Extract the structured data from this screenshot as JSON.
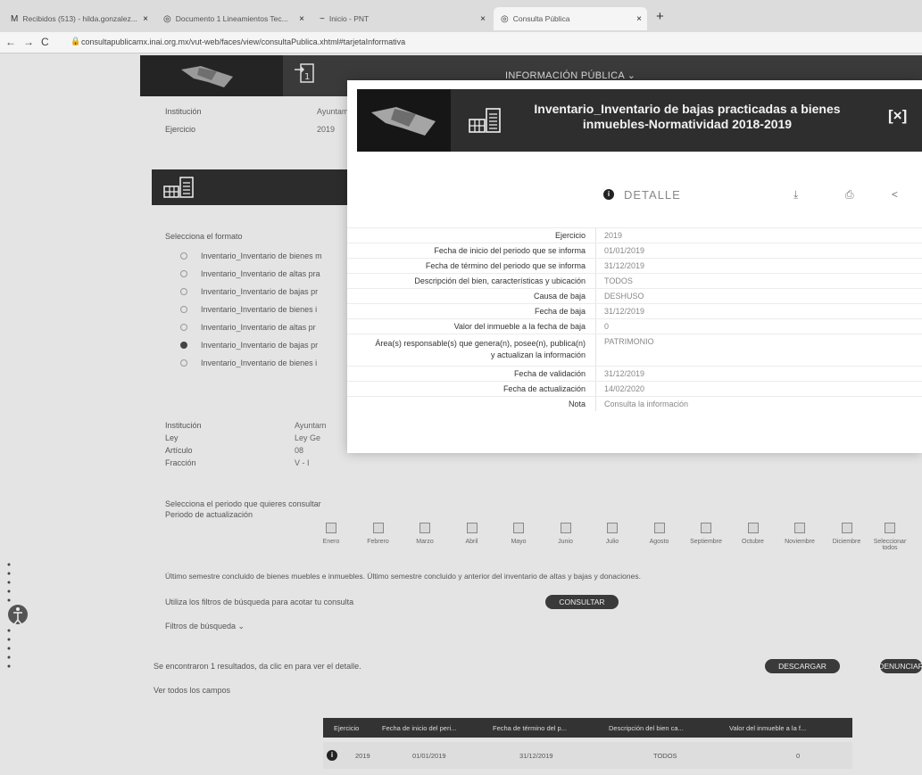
{
  "browser": {
    "tabs": [
      {
        "icon": "M",
        "label": "Recibidos (513) - hilda.gonzalez..."
      },
      {
        "icon": "◎",
        "label": "Documento 1 Lineamientos Tec..."
      },
      {
        "icon": "~",
        "label": "Inicio - PNT"
      },
      {
        "icon": "◎",
        "label": "Consulta Pública"
      }
    ],
    "url": "consultapublicamx.inai.org.mx/vut-web/faces/view/consultaPublica.xhtml#tarjetaInformativa"
  },
  "header": {
    "title": "INFORMACIÓN PÚBLICA ⌄"
  },
  "background": {
    "institucion_label": "Institución",
    "institucion_value": "Ayuntam",
    "ejercicio_label": "Ejercicio",
    "ejercicio_value": "2019",
    "formato_label": "Selecciona el formato",
    "formatos": [
      "Inventario_Inventario de bienes m",
      "Inventario_Inventario de altas pra",
      "Inventario_Inventario de bajas pr",
      "Inventario_Inventario de bienes i",
      "Inventario_Inventario de altas pr",
      "Inventario_Inventario de bajas pr",
      "Inventario_Inventario de bienes i"
    ],
    "selected_formato": 5,
    "meta": [
      {
        "label": "Institución",
        "value": "Ayuntam"
      },
      {
        "label": "Ley",
        "value": "Ley Ge"
      },
      {
        "label": "Artículo",
        "value": "08"
      },
      {
        "label": "Fracción",
        "value": "V - I"
      }
    ],
    "periodo_prompt": "Selecciona el periodo que quieres consultar",
    "periodo_label": "Periodo de actualización",
    "months": [
      "Enero",
      "Febrero",
      "Marzo",
      "Abril",
      "Mayo",
      "Junio",
      "Julio",
      "Agosto",
      "Septiembre",
      "Octubre",
      "Noviembre",
      "Diciembre"
    ],
    "all_periods": "Seleccionar todos",
    "semester_note": "Último semestre concluido de bienes muebles e inmuebles. Último semestre concluido y anterior del inventario de altas y bajas y donaciones.",
    "filter_hint": "Utiliza los filtros de búsqueda para acotar tu consulta",
    "consultar": "CONSULTAR",
    "filtros": "Filtros de búsqueda ⌄",
    "results_text": "Se encontraron 1 resultados, da clic en  para ver el detalle.",
    "descargar": "DESCARGAR",
    "denunciar": "DENUNCIAR",
    "ver_todos": "Ver todos los campos",
    "table_headers": [
      "Ejercicio",
      "Fecha de inicio del peri...",
      "Fecha de término del p...",
      "Descripción del bien ca...",
      "Valor del inmueble a la f..."
    ],
    "table_row": [
      "2019",
      "01/01/2019",
      "31/12/2019",
      "TODOS",
      "0"
    ]
  },
  "modal": {
    "title": "Inventario_Inventario de bajas practicadas a bienes inmuebles-Normatividad 2018-2019",
    "close": "[×]",
    "detalle": "DETALLE",
    "info_glyph": "i",
    "rows": [
      {
        "label": "Ejercicio",
        "value": "2019"
      },
      {
        "label": "Fecha de inicio del periodo que se informa",
        "value": "01/01/2019"
      },
      {
        "label": "Fecha de término del periodo que se informa",
        "value": "31/12/2019"
      },
      {
        "label": "Descripción del bien, características y ubicación",
        "value": "TODOS"
      },
      {
        "label": "Causa de baja",
        "value": "DESHUSO"
      },
      {
        "label": "Fecha de baja",
        "value": "31/12/2019"
      },
      {
        "label": "Valor del inmueble a la fecha de baja",
        "value": "0"
      },
      {
        "label": "Área(s) responsable(s) que genera(n), posee(n), publica(n) y actualizan la información",
        "value": "PATRIMONIO"
      },
      {
        "label": "Fecha de validación",
        "value": "31/12/2019"
      },
      {
        "label": "Fecha de actualización",
        "value": "14/02/2020"
      },
      {
        "label": "Nota",
        "value": "Consulta la información"
      }
    ]
  }
}
